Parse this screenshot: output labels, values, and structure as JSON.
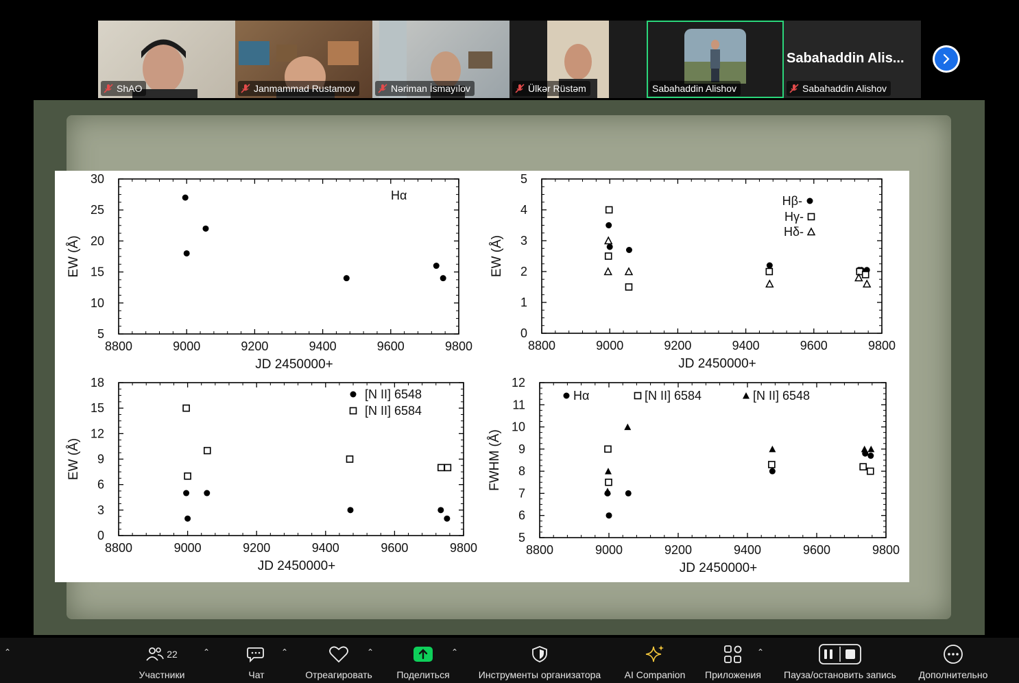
{
  "participants_gallery": [
    {
      "name": "ShAO",
      "muted": true
    },
    {
      "name": "Janmammad Rustamov",
      "muted": true
    },
    {
      "name": "Nəriman İsmayılov",
      "muted": true
    },
    {
      "name": "Ülkər Rüstəm",
      "muted": true
    },
    {
      "name": "Sabahaddin Alishov",
      "muted": false,
      "active": true
    },
    {
      "name": "Sabahaddin Alishov",
      "muted": true,
      "display_title": "Sabahaddin  Alis..."
    }
  ],
  "chart_data": [
    {
      "type": "scatter",
      "xlabel": "JD 2450000+",
      "ylabel": "EW (Å)",
      "xlim": [
        8800,
        9800
      ],
      "ylim": [
        5,
        30
      ],
      "xticks": [
        8800,
        9000,
        9200,
        9400,
        9600,
        9800
      ],
      "yticks": [
        5,
        10,
        15,
        20,
        25,
        30
      ],
      "series": [
        {
          "name": "Hα",
          "marker": "filled-circle",
          "x": [
            8996,
            9000,
            9056,
            9470,
            9734,
            9754
          ],
          "y": [
            27,
            18,
            22,
            14,
            16,
            14
          ]
        }
      ]
    },
    {
      "type": "scatter",
      "xlabel": "JD 2450000+",
      "ylabel": "EW (Å)",
      "xlim": [
        8800,
        9800
      ],
      "ylim": [
        0,
        5
      ],
      "xticks": [
        8800,
        9000,
        9200,
        9400,
        9600,
        9800
      ],
      "yticks": [
        0,
        1,
        2,
        3,
        4,
        5
      ],
      "legend": [
        "Hβ-",
        "Hγ-",
        "Hδ-"
      ],
      "series": [
        {
          "name": "Hβ-",
          "marker": "filled-circle",
          "x": [
            8997,
            9000,
            9057,
            9470,
            9733,
            9740,
            9756
          ],
          "y": [
            3.5,
            2.8,
            2.7,
            2.2,
            2.05,
            2.05,
            2.05
          ]
        },
        {
          "name": "Hγ-",
          "marker": "open-square",
          "x": [
            8998,
            8996,
            9056,
            9469,
            9735,
            9752
          ],
          "y": [
            4.0,
            2.5,
            1.5,
            2.0,
            2.0,
            1.9
          ]
        },
        {
          "name": "Hδ-",
          "marker": "open-triangle",
          "x": [
            8996,
            8995,
            9056,
            9470,
            9732,
            9756
          ],
          "y": [
            3.0,
            2.0,
            2.0,
            1.6,
            1.8,
            1.6
          ]
        }
      ]
    },
    {
      "type": "scatter",
      "xlabel": "JD 2450000+",
      "ylabel": "EW (Å)",
      "xlim": [
        8800,
        9800
      ],
      "ylim": [
        0,
        18
      ],
      "xticks": [
        8800,
        9000,
        9200,
        9400,
        9600,
        9800
      ],
      "yticks": [
        0,
        3,
        6,
        9,
        12,
        15,
        18
      ],
      "legend": [
        "[N II] 6548",
        "[N II] 6584"
      ],
      "series": [
        {
          "name": "[N II] 6548",
          "marker": "filled-circle",
          "x": [
            8996,
            9000,
            9056,
            9472,
            9734,
            9752
          ],
          "y": [
            5,
            2,
            5,
            3,
            3,
            2
          ]
        },
        {
          "name": "[N II] 6584",
          "marker": "open-square",
          "x": [
            8996,
            9000,
            9057,
            9470,
            9735,
            9754
          ],
          "y": [
            15,
            7,
            10,
            9,
            8,
            8
          ]
        }
      ]
    },
    {
      "type": "scatter",
      "xlabel": "JD 2450000+",
      "ylabel": "FWHM (Å)",
      "xlim": [
        8800,
        9800
      ],
      "ylim": [
        5,
        12
      ],
      "xticks": [
        8800,
        9000,
        9200,
        9400,
        9600,
        9800
      ],
      "yticks": [
        5,
        6,
        7,
        8,
        9,
        10,
        11,
        12
      ],
      "legend": [
        "Hα",
        "[N II] 6584",
        "[N II] 6548"
      ],
      "series": [
        {
          "name": "Hα",
          "marker": "filled-circle",
          "x": [
            8996,
            9000,
            9056,
            9472,
            9740,
            9756
          ],
          "y": [
            7,
            6,
            7,
            8,
            8.8,
            8.7
          ]
        },
        {
          "name": "[N II] 6584",
          "marker": "open-square",
          "x": [
            8997,
            8999,
            9470,
            9734,
            9755
          ],
          "y": [
            9,
            7.5,
            8.3,
            8.2,
            8
          ]
        },
        {
          "name": "[N II] 6548",
          "marker": "filled-triangle",
          "x": [
            8998,
            8996,
            9054,
            9472,
            9738,
            9757
          ],
          "y": [
            8,
            7.1,
            10,
            9,
            9,
            9
          ]
        }
      ]
    }
  ],
  "toolbar": {
    "participants_label": "Участники",
    "participants_count": "22",
    "chat_label": "Чат",
    "react_label": "Отреагировать",
    "share_label": "Поделиться",
    "host_tools_label": "Инструменты организатора",
    "ai_label": "AI Companion",
    "apps_label": "Приложения",
    "record_label": "Пауза/остановить запись",
    "more_label": "Дополнительно"
  },
  "colors": {
    "active_speaker": "#2bd67b",
    "share_green": "#0ecf5a",
    "ai_star": "#f3c63c",
    "scroll_blue": "#1a6ee8"
  }
}
